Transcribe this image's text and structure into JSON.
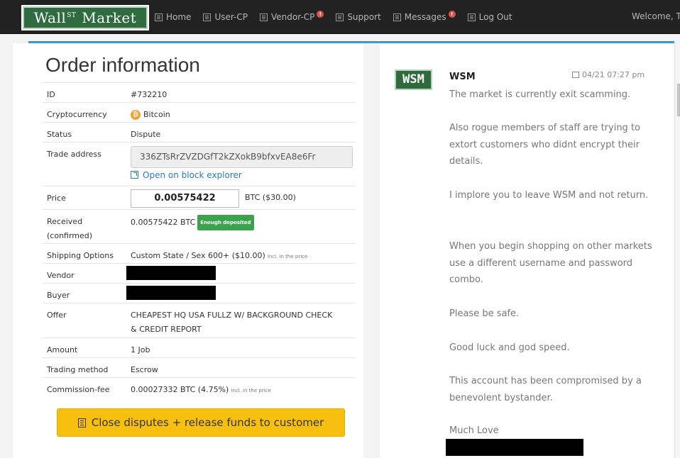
{
  "brand": {
    "text_main": "Wall",
    "text_sup": "ST",
    "text_end": "Market"
  },
  "nav": [
    {
      "label": "Home",
      "icon": "home-icon",
      "badge": null
    },
    {
      "label": "User-CP",
      "icon": "user-icon",
      "badge": null
    },
    {
      "label": "Vendor-CP",
      "icon": "vendor-icon",
      "badge": "!"
    },
    {
      "label": "Support",
      "icon": "support-icon",
      "badge": null
    },
    {
      "label": "Messages",
      "icon": "messages-icon",
      "badge": "!"
    },
    {
      "label": "Log Out",
      "icon": "logout-icon",
      "badge": null
    }
  ],
  "welcome": "Welcome, T",
  "order": {
    "title": "Order information",
    "rows": {
      "id": {
        "label": "ID",
        "value": "#732210"
      },
      "crypto": {
        "label": "Cryptocurrency",
        "value": "Bitcoin",
        "icon": "bitcoin-icon"
      },
      "status": {
        "label": "Status",
        "value": "Dispute"
      },
      "trade_address": {
        "label": "Trade address",
        "value": "336ZTsRrZVZDGfT2kZXokB9bfxvEA8e6Fr",
        "link": "Open on block explorer"
      },
      "price": {
        "label": "Price",
        "value": "0.00575422",
        "suffix": "BTC ($30.00)"
      },
      "received": {
        "label": "Received (confirmed)",
        "value": "0.00575422 BTC",
        "badge": "Enough deposited"
      },
      "shipping": {
        "label": "Shipping Options",
        "value": "Custom State / Sex 600+ ($10.00)",
        "note": "Incl. in the price"
      },
      "vendor": {
        "label": "Vendor"
      },
      "buyer": {
        "label": "Buyer"
      },
      "offer": {
        "label": "Offer",
        "value": "CHEAPEST HQ USA FULLZ W/ BACKGROUND CHECK & CREDIT REPORT"
      },
      "amount": {
        "label": "Amount",
        "value": "1 Job"
      },
      "trading": {
        "label": "Trading method",
        "value": "Escrow"
      },
      "commission": {
        "label": "Commission-fee",
        "value": "0.00027332 BTC (4.75%)",
        "note": "Incl. in the price"
      }
    },
    "action_button": "Close disputes + release funds to customer"
  },
  "message": {
    "logo": "WSM",
    "author": "WSM",
    "time": "04/21 07:27 pm",
    "paragraphs": [
      "The market is currently exit scamming.",
      "Also rogue members of staff are trying to extort customers who didnt encrypt their details.",
      "I implore you to leave WSM and not return.",
      "When you begin shopping on other markets use a different username and password combo.",
      "Please be safe.",
      "Good luck and god speed.",
      "This account has been compromised by a benevolent bystander.",
      "Much Love"
    ]
  }
}
